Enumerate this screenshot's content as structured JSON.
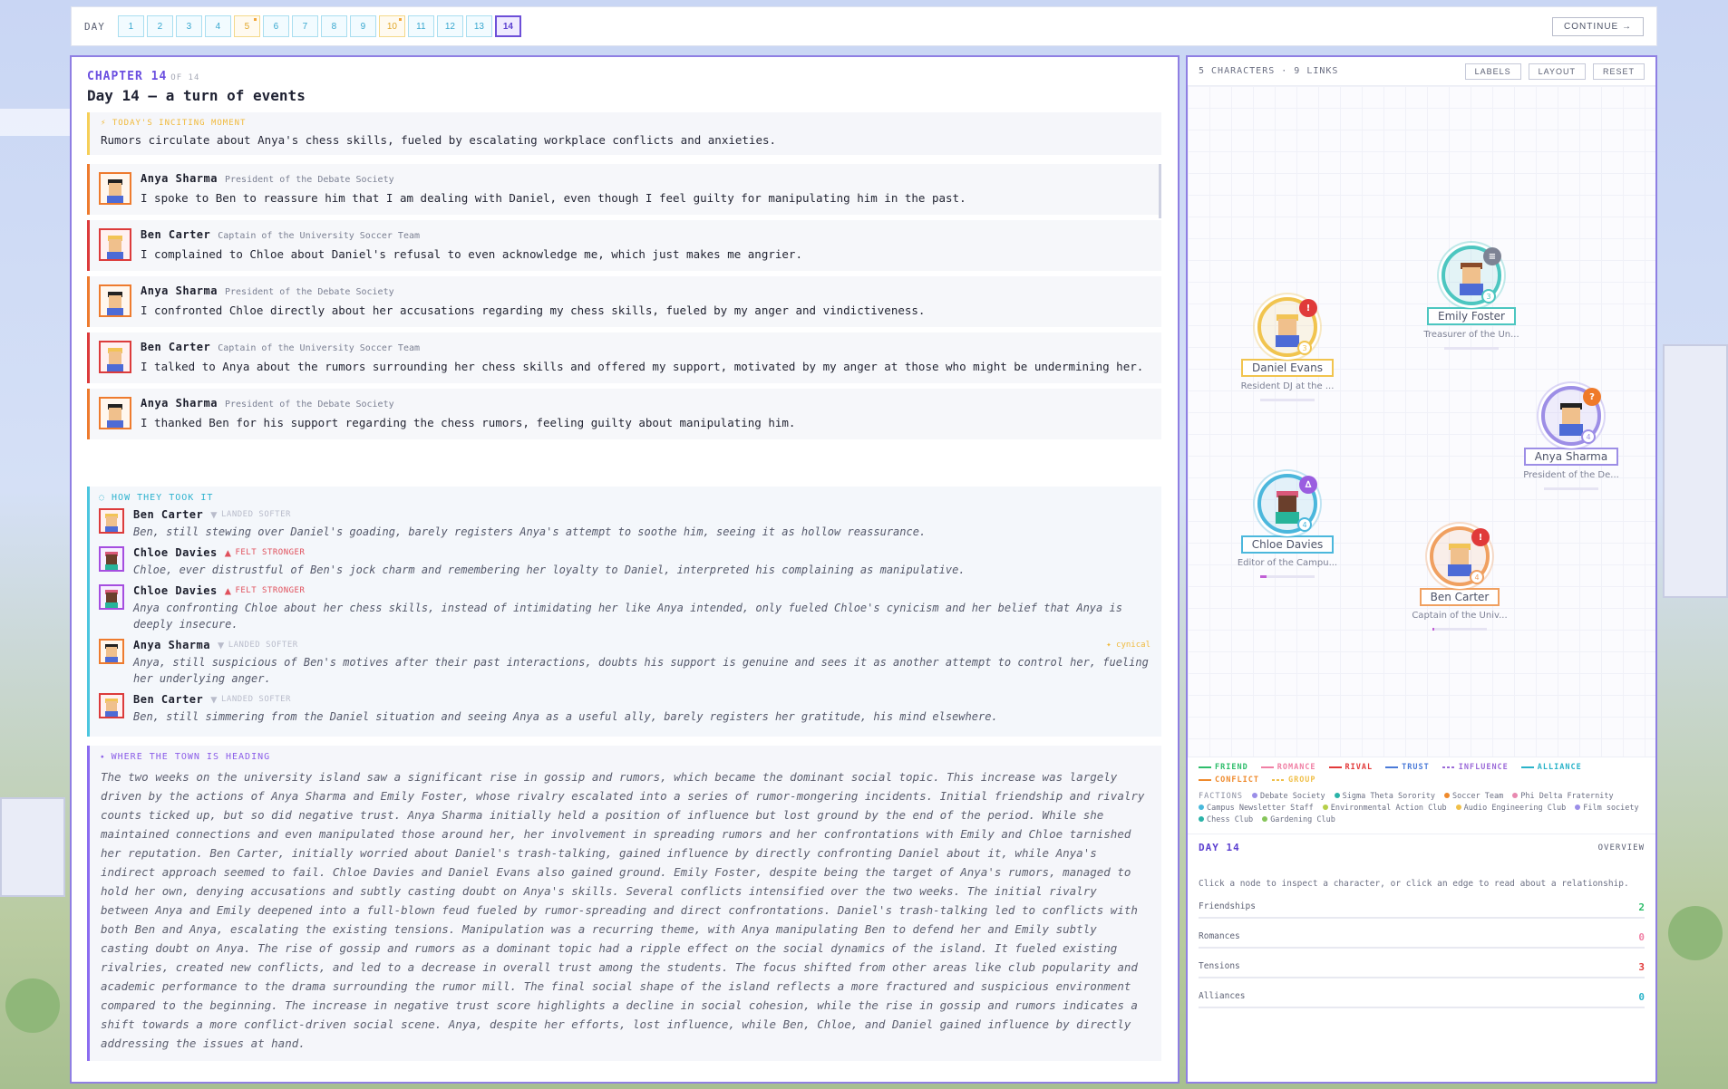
{
  "daybar": {
    "label": "DAY",
    "days": [
      {
        "n": "1",
        "event": false
      },
      {
        "n": "2",
        "event": false
      },
      {
        "n": "3",
        "event": false
      },
      {
        "n": "4",
        "event": false
      },
      {
        "n": "5",
        "event": true
      },
      {
        "n": "6",
        "event": false
      },
      {
        "n": "7",
        "event": false
      },
      {
        "n": "8",
        "event": false
      },
      {
        "n": "9",
        "event": false
      },
      {
        "n": "10",
        "event": true
      },
      {
        "n": "11",
        "event": false
      },
      {
        "n": "12",
        "event": false
      },
      {
        "n": "13",
        "event": false
      },
      {
        "n": "14",
        "event": false,
        "active": true
      }
    ],
    "continue_label": "CONTINUE →"
  },
  "story": {
    "chapter_label": "CHAPTER 14",
    "chapter_of": "OF 14",
    "title": "Day 14 — a turn of events",
    "inciting_label": "⚡ TODAY'S INCITING MOMENT",
    "inciting_text": "Rumors circulate about Anya's chess skills, fueled by escalating workplace conflicts and anxieties.",
    "turns": [
      {
        "name": "Anya Sharma",
        "role": "President of the Debate Society",
        "text": "I spoke to Ben to reassure him that I am dealing with Daniel, even though I feel guilty for manipulating him in the past."
      },
      {
        "name": "Ben Carter",
        "role": "Captain of the University Soccer Team",
        "text": "I complained to Chloe about Daniel's refusal to even acknowledge me, which just makes me angrier."
      },
      {
        "name": "Anya Sharma",
        "role": "President of the Debate Society",
        "text": "I confronted Chloe directly about her accusations regarding my chess skills, fueled by my anger and vindictiveness."
      },
      {
        "name": "Ben Carter",
        "role": "Captain of the University Soccer Team",
        "text": "I talked to Anya about the rumors surrounding her chess skills and offered my support, motivated by my anger at those who might be undermining her."
      },
      {
        "name": "Anya Sharma",
        "role": "President of the Debate Society",
        "text": "I thanked Ben for his support regarding the chess rumors, feeling guilty about manipulating him."
      }
    ],
    "reactions_label": "◌ HOW THEY TOOK IT",
    "reactions": [
      {
        "name": "Ben Carter",
        "arrow": "▼",
        "tag": "LANDED SOFTER",
        "trait": "",
        "text": "Ben, still stewing over Daniel's goading, barely registers Anya's attempt to soothe him, seeing it as hollow reassurance."
      },
      {
        "name": "Chloe Davies",
        "arrow": "▲",
        "tag": "FELT STRONGER",
        "trait": "",
        "text": "Chloe, ever distrustful of Ben's jock charm and remembering her loyalty to Daniel, interpreted his complaining as manipulative."
      },
      {
        "name": "Chloe Davies",
        "arrow": "▲",
        "tag": "FELT STRONGER",
        "trait": "",
        "text": "Anya confronting Chloe about her chess skills, instead of intimidating her like Anya intended, only fueled Chloe's cynicism and her belief that Anya is deeply insecure."
      },
      {
        "name": "Anya Sharma",
        "arrow": "▼",
        "tag": "LANDED SOFTER",
        "trait": "✦ cynical",
        "text": "Anya, still suspicious of Ben's motives after their past interactions, doubts his support is genuine and sees it as another attempt to control her, fueling her underlying anger."
      },
      {
        "name": "Ben Carter",
        "arrow": "▼",
        "tag": "LANDED SOFTER",
        "trait": "",
        "text": "Ben, still simmering from the Daniel situation and seeing Anya as a useful ally, barely registers her gratitude, his mind elsewhere."
      }
    ],
    "heading_label": "⬩ WHERE THE TOWN IS HEADING",
    "heading_text": "The two weeks on the university island saw a significant rise in gossip and rumors, which became the dominant social topic. This increase was largely driven by the actions of Anya Sharma and Emily Foster, whose rivalry escalated into a series of rumor-mongering incidents. Initial friendship and rivalry counts ticked up, but so did negative trust. Anya Sharma initially held a position of influence but lost ground by the end of the period. While she maintained connections and even manipulated those around her, her involvement in spreading rumors and her confrontations with Emily and Chloe tarnished her reputation. Ben Carter, initially worried about Daniel's trash-talking, gained influence by directly confronting Daniel about it, while Anya's indirect approach seemed to fail. Chloe Davies and Daniel Evans also gained ground. Emily Foster, despite being the target of Anya's rumors, managed to hold her own, denying accusations and subtly casting doubt on Anya's skills. Several conflicts intensified over the two weeks. The initial rivalry between Anya and Emily deepened into a full-blown feud fueled by rumor-spreading and direct confrontations. Daniel's trash-talking led to conflicts with both Ben and Anya, escalating the existing tensions. Manipulation was a recurring theme, with Anya manipulating Ben to defend her and Emily subtly casting doubt on Anya. The rise of gossip and rumors as a dominant topic had a ripple effect on the social dynamics of the island. It fueled existing rivalries, created new conflicts, and led to a decrease in overall trust among the students. The focus shifted from other areas like club popularity and academic performance to the drama surrounding the rumor mill. The final social shape of the island reflects a more fractured and suspicious environment compared to the beginning. The increase in negative trust score highlights a decline in social cohesion, while the rise in gossip and rumors indicates a shift towards a more conflict-driven social scene. Anya, despite her efforts, lost influence, while Ben, Chloe, and Daniel gained influence by directly addressing the issues at hand."
  },
  "graph": {
    "stats": "5 CHARACTERS · 9 LINKS",
    "btn_labels": "LABELS",
    "btn_layout": "LAYOUT",
    "btn_reset": "RESET",
    "nodes": [
      {
        "name": "Emily Foster",
        "role": "Treasurer of the Un...",
        "badge": "≡",
        "count": "3",
        "color": "#4cc6c0",
        "badge_color": "#7d8394",
        "bar": 0
      },
      {
        "name": "Daniel Evans",
        "role": "Resident DJ at the ...",
        "badge": "!",
        "count": "3",
        "color": "#f1c44e",
        "badge_color": "#e03a3a",
        "bar": 0
      },
      {
        "name": "Anya Sharma",
        "role": "President of the De...",
        "badge": "?",
        "count": "4",
        "color": "#9d8ee6",
        "badge_color": "#ef7a2a",
        "bar": 0
      },
      {
        "name": "Chloe Davies",
        "role": "Editor of the Campu...",
        "badge": "∆",
        "count": "4",
        "color": "#4bb7dc",
        "badge_color": "#9a5de0",
        "bar": 0.12
      },
      {
        "name": "Ben Carter",
        "role": "Captain of the Univ...",
        "badge": "!",
        "count": "4",
        "color": "#f0a060",
        "badge_color": "#e03a3a",
        "bar": 0.04
      }
    ],
    "legend": [
      {
        "label": "FRIEND",
        "color": "#2ebd6b",
        "dashed": false
      },
      {
        "label": "ROMANCE",
        "color": "#f07fa4",
        "dashed": false
      },
      {
        "label": "RIVAL",
        "color": "#e23a3a",
        "dashed": false
      },
      {
        "label": "TRUST",
        "color": "#4a7ad8",
        "dashed": false
      },
      {
        "label": "INFLUENCE",
        "color": "#9b6ad8",
        "dashed": true
      },
      {
        "label": "ALLIANCE",
        "color": "#2ab3c9",
        "dashed": false
      },
      {
        "label": "CONFLICT",
        "color": "#ef8a2c",
        "dashed": false
      },
      {
        "label": "GROUP",
        "color": "#f0c04a",
        "dashed": true
      }
    ],
    "factions_title": "FACTIONS",
    "factions": [
      {
        "label": "Debate Society",
        "color": "#9b8ee8"
      },
      {
        "label": "Sigma Theta Sorority",
        "color": "#2ab3a8"
      },
      {
        "label": "Soccer Team",
        "color": "#ef8a2c"
      },
      {
        "label": "Phi Delta Fraternity",
        "color": "#e889b0"
      },
      {
        "label": "Campus Newsletter Staff",
        "color": "#49b9dc"
      },
      {
        "label": "Environmental Action Club",
        "color": "#b6cf4a"
      },
      {
        "label": "Audio Engineering Club",
        "color": "#f0c04a"
      },
      {
        "label": "Film society",
        "color": "#9b8ee8"
      },
      {
        "label": "Chess Club",
        "color": "#2ab3a8"
      },
      {
        "label": "Gardening Club",
        "color": "#86c55a"
      }
    ],
    "summary": {
      "day": "DAY 14",
      "overview": "OVERVIEW",
      "hint": "Click a node to inspect a character, or click an edge to read about a relationship.",
      "stats": [
        {
          "label": "Friendships",
          "value": "2",
          "color": "#2ebd6b"
        },
        {
          "label": "Romances",
          "value": "0",
          "color": "#f07fa4"
        },
        {
          "label": "Tensions",
          "value": "3",
          "color": "#e23a3a"
        },
        {
          "label": "Alliances",
          "value": "0",
          "color": "#2ab3c9"
        }
      ]
    }
  }
}
